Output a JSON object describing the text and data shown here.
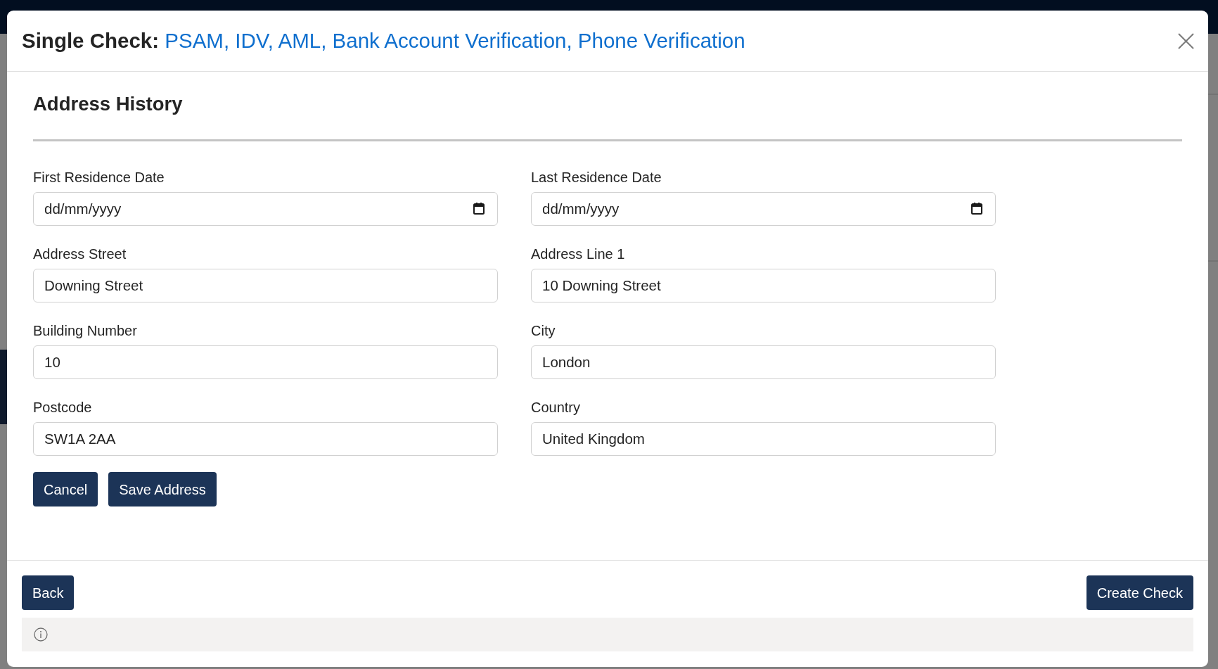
{
  "dialog": {
    "title": {
      "label": "Single Check:",
      "checks": "PSAM, IDV, AML, Bank Account Verification, Phone Verification"
    }
  },
  "section": {
    "heading": "Address History"
  },
  "fields": [
    {
      "label": "First Residence Date",
      "kind": "date",
      "placeholder": "dd/mm/yyyy"
    },
    {
      "label": "Last Residence Date",
      "kind": "date",
      "placeholder": "dd/mm/yyyy"
    },
    {
      "label": "Address Street",
      "kind": "text",
      "value": "Downing Street"
    },
    {
      "label": "Address Line 1",
      "kind": "text",
      "value": "10 Downing Street"
    },
    {
      "label": "Building Number",
      "kind": "text",
      "value": "10"
    },
    {
      "label": "City",
      "kind": "text",
      "value": "London"
    },
    {
      "label": "Postcode",
      "kind": "text",
      "value": "SW1A 2AA"
    },
    {
      "label": "Country",
      "kind": "text",
      "value": "United Kingdom"
    }
  ],
  "form_buttons": [
    {
      "label": "Cancel"
    },
    {
      "label": "Save Address"
    }
  ],
  "footer": {
    "back_button": "Back",
    "create_button": "Create Check"
  }
}
